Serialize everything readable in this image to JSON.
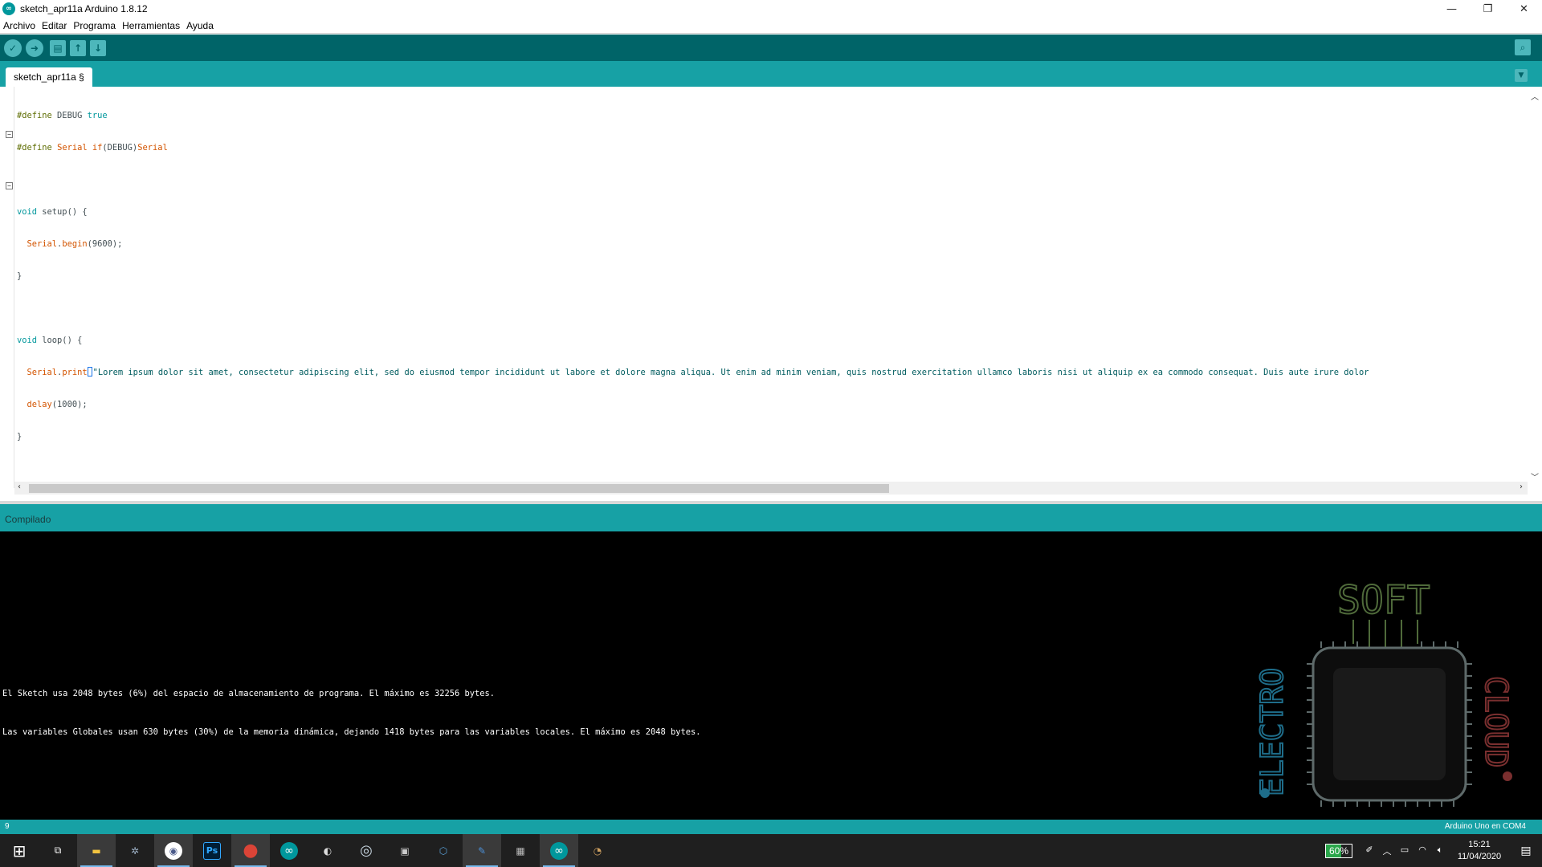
{
  "window": {
    "title": "sketch_apr11a Arduino 1.8.12",
    "app_icon": "arduino-infinity-icon",
    "minimize_glyph": "—",
    "maximize_glyph": "❐",
    "close_glyph": "✕"
  },
  "menu": {
    "items": [
      "Archivo",
      "Editar",
      "Programa",
      "Herramientas",
      "Ayuda"
    ]
  },
  "toolbar": {
    "buttons": [
      {
        "name": "verify-icon",
        "glyph": "✓"
      },
      {
        "name": "upload-icon",
        "glyph": "➜"
      },
      {
        "name": "new-icon",
        "glyph": "▤"
      },
      {
        "name": "open-icon",
        "glyph": "↑"
      },
      {
        "name": "save-icon",
        "glyph": "↓"
      }
    ],
    "serial_monitor_glyph": "⌕"
  },
  "tabs": {
    "active": "sketch_apr11a §",
    "menu_glyph": "▼"
  },
  "code": {
    "l1_pp": "#define",
    "l1_name": " DEBUG ",
    "l1_val": "true",
    "l2_pp": "#define",
    "l2_sp": " ",
    "l2_serial": "Serial",
    "l2_if": " if",
    "l2_cond": "(DEBUG)",
    "l2_serial2": "Serial",
    "l4_void": "void",
    "l4_rest": " setup() {",
    "l5_serial": "  Serial",
    "l5_dot": ".",
    "l5_fn": "begin",
    "l5_rest": "(9600);",
    "l6": "}",
    "l8_void": "void",
    "l8_rest": " loop() {",
    "l9_serial": "  Serial",
    "l9_dot": ".",
    "l9_fn": "print",
    "l9_str": "\"Lorem ipsum dolor sit amet, consectetur adipiscing elit, sed do eiusmod tempor incididunt ut labore et dolore magna aliqua. Ut enim ad minim veniam, quis nostrud exercitation ullamco laboris nisi ut aliquip ex ea commodo consequat. Duis aute irure dolor",
    "l10_fn": "  delay",
    "l10_rest": "(1000);",
    "l11": "}"
  },
  "status": {
    "message": "Compilado"
  },
  "console": {
    "line1": "El Sketch usa 2048 bytes (6%) del espacio de almacenamiento de programa. El máximo es 32256 bytes.",
    "line2": "Las variables Globales usan 630 bytes (30%) de la memoria dinámica, dejando 1418 bytes para las variables locales. El máximo es 2048 bytes."
  },
  "logo": {
    "top_text": "SOFT",
    "left_text": "ELECTRO",
    "right_text": "CLOUD"
  },
  "bottom": {
    "line_number": "9",
    "board": "Arduino Uno en COM4"
  },
  "taskbar": {
    "apps": [
      {
        "name": "windows-start-icon",
        "glyph": "⊞",
        "color": "#ffffff",
        "active": false
      },
      {
        "name": "task-view-icon",
        "glyph": "⧉",
        "color": "#ffffff",
        "active": false
      },
      {
        "name": "file-explorer-icon",
        "glyph": "▬",
        "color": "#f3c440",
        "active": true
      },
      {
        "name": "drone-app-icon",
        "glyph": "✲",
        "color": "#9fb3c8",
        "active": false
      },
      {
        "name": "vpn-lock-icon",
        "glyph": "◉",
        "color": "#4a5a8a",
        "active": true
      },
      {
        "name": "photoshop-icon",
        "glyph": "Ps",
        "color": "#001e36",
        "active": false
      },
      {
        "name": "chrome-icon",
        "glyph": "●",
        "color": "#db4437",
        "active": true
      },
      {
        "name": "arduino-icon",
        "glyph": "∞",
        "color": "#00979c",
        "active": false
      },
      {
        "name": "cura-icon",
        "glyph": "◐",
        "color": "#dddddd",
        "active": false
      },
      {
        "name": "steam-icon",
        "glyph": "◎",
        "color": "#1b2838",
        "active": false
      },
      {
        "name": "sd-card-icon",
        "glyph": "▣",
        "color": "#cccccc",
        "active": false
      },
      {
        "name": "virtualbox-icon",
        "glyph": "⬡",
        "color": "#5aa0d8",
        "active": false
      },
      {
        "name": "tool-app-icon",
        "glyph": "✎",
        "color": "#4c90d8",
        "active": true
      },
      {
        "name": "dot-matrix-icon",
        "glyph": "▦",
        "color": "#bbbbbb",
        "active": false
      },
      {
        "name": "arduino-active-icon",
        "glyph": "∞",
        "color": "#00979c",
        "active": true
      },
      {
        "name": "paint-icon",
        "glyph": "◔",
        "color": "#cfa060",
        "active": false
      }
    ],
    "battery_percent": "60%",
    "battery_level": 0.6,
    "tray_icons": [
      {
        "name": "pen-icon",
        "glyph": "✐"
      },
      {
        "name": "show-hidden-icons-icon",
        "glyph": "︿"
      },
      {
        "name": "battery-tray-icon",
        "glyph": "▭"
      },
      {
        "name": "wifi-icon",
        "glyph": "◠"
      },
      {
        "name": "volume-icon",
        "glyph": "🔈︎"
      }
    ],
    "time": "15:21",
    "date": "11/04/2020",
    "notification_glyph": "▤"
  }
}
